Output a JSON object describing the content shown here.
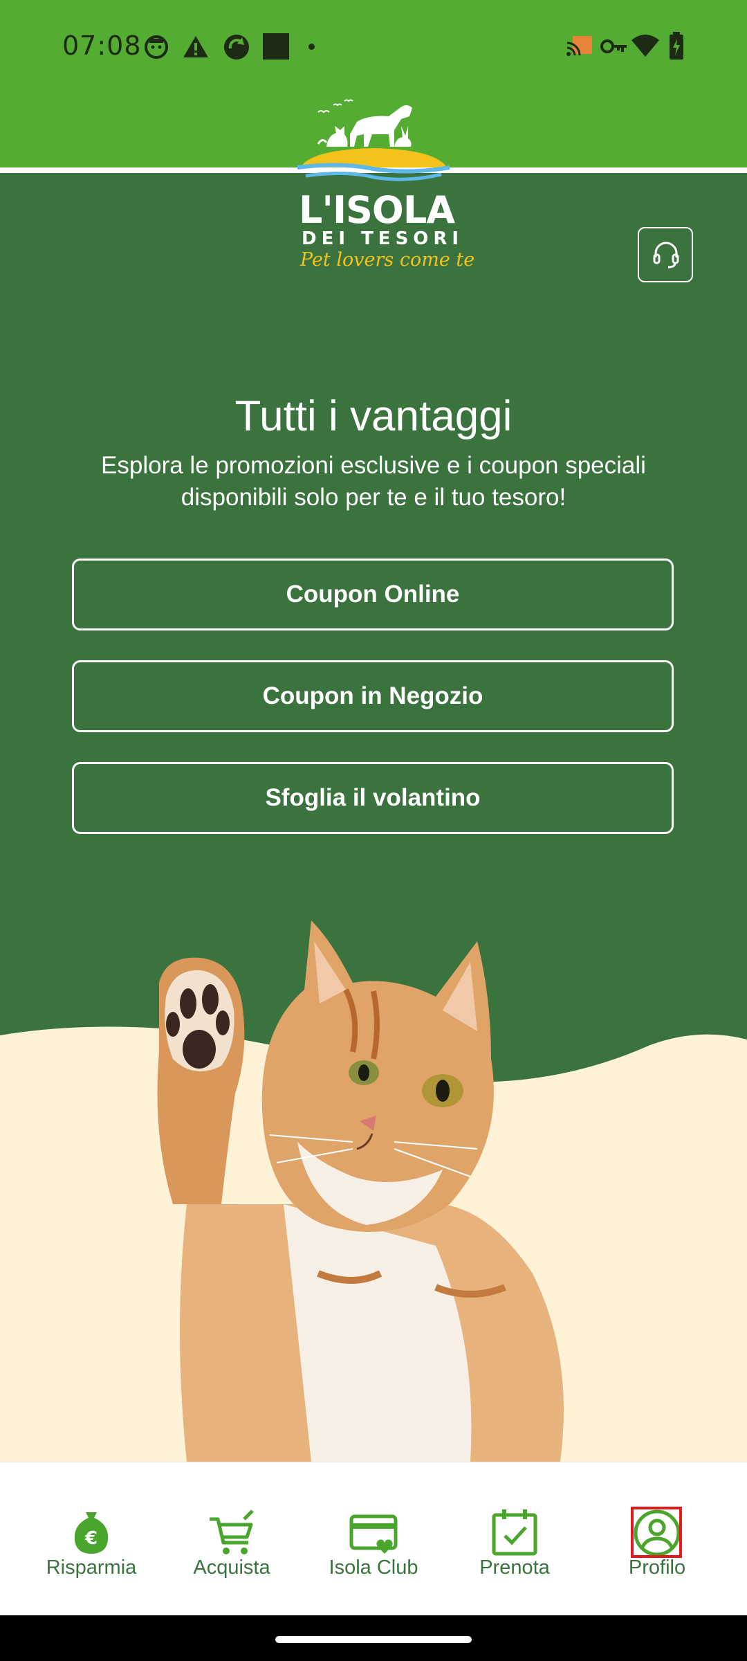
{
  "status_bar": {
    "time": "07:08",
    "left_icons": [
      "face-icon",
      "warning-icon",
      "sync-icon",
      "square-icon",
      "dot-icon"
    ],
    "right_icons": [
      "cast-icon",
      "vpn-key-icon",
      "wifi-icon",
      "battery-charging-icon"
    ]
  },
  "brand": {
    "name_line1": "L'ISOLA",
    "name_line2": "DEI TESORI",
    "tagline": "Pet lovers come te",
    "colors": {
      "header_green": "#55ac32",
      "main_green": "#3a733d",
      "tagline_yellow": "#f5c21b",
      "cream": "#fdf2d6"
    }
  },
  "support_button": {
    "icon": "headset-icon"
  },
  "hero": {
    "title": "Tutti i vantaggi",
    "subtitle": "Esplora le promozioni esclusive e i coupon speciali disponibili solo per te e il tuo tesoro!"
  },
  "buttons": {
    "coupon_online": "Coupon Online",
    "coupon_store": "Coupon in Negozio",
    "flyer": "Sfoglia il volantino"
  },
  "bottom_nav": {
    "items": [
      {
        "label": "Risparmia",
        "icon": "euro-bag-icon"
      },
      {
        "label": "Acquista",
        "icon": "cart-icon"
      },
      {
        "label": "Isola Club",
        "icon": "card-heart-icon"
      },
      {
        "label": "Prenota",
        "icon": "calendar-check-icon"
      },
      {
        "label": "Profilo",
        "icon": "profile-icon"
      }
    ]
  }
}
